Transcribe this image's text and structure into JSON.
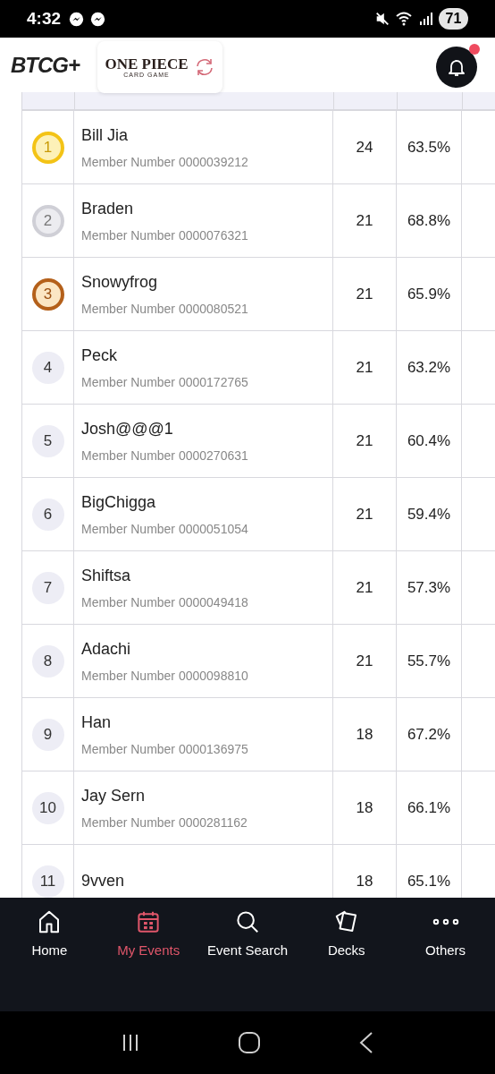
{
  "status_bar": {
    "time": "4:32",
    "battery": "71"
  },
  "header": {
    "logo": "BTCG+",
    "game_logo": {
      "title": "ONE PIECE",
      "subtitle": "CARD GAME"
    },
    "notification_badge": true
  },
  "standings": {
    "rows": [
      {
        "rank": "1",
        "kind": "gold",
        "name": "Bill Jia",
        "member": "Member Number 0000039212",
        "points": "24",
        "percent": "63.5%"
      },
      {
        "rank": "2",
        "kind": "silver",
        "name": "Braden",
        "member": "Member Number 0000076321",
        "points": "21",
        "percent": "68.8%"
      },
      {
        "rank": "3",
        "kind": "bronze",
        "name": "Snowyfrog",
        "member": "Member Number 0000080521",
        "points": "21",
        "percent": "65.9%"
      },
      {
        "rank": "4",
        "kind": "plain",
        "name": "Peck",
        "member": "Member Number 0000172765",
        "points": "21",
        "percent": "63.2%"
      },
      {
        "rank": "5",
        "kind": "plain",
        "name": "Josh@@@1",
        "member": "Member Number 0000270631",
        "points": "21",
        "percent": "60.4%"
      },
      {
        "rank": "6",
        "kind": "plain",
        "name": "BigChigga",
        "member": "Member Number 0000051054",
        "points": "21",
        "percent": "59.4%"
      },
      {
        "rank": "7",
        "kind": "plain",
        "name": "Shiftsa",
        "member": "Member Number 0000049418",
        "points": "21",
        "percent": "57.3%"
      },
      {
        "rank": "8",
        "kind": "plain",
        "name": "Adachi",
        "member": "Member Number 0000098810",
        "points": "21",
        "percent": "55.7%"
      },
      {
        "rank": "9",
        "kind": "plain",
        "name": "Han",
        "member": "Member Number 0000136975",
        "points": "18",
        "percent": "67.2%"
      },
      {
        "rank": "10",
        "kind": "plain",
        "name": "Jay Sern",
        "member": "Member Number 0000281162",
        "points": "18",
        "percent": "66.1%"
      },
      {
        "rank": "11",
        "kind": "plain",
        "name": "9vven",
        "points": "18",
        "percent": "65.1%"
      }
    ]
  },
  "bottom_nav": [
    {
      "label": "Home",
      "kind": "home",
      "selected": false
    },
    {
      "label": "My Events",
      "kind": "calendar",
      "selected": true
    },
    {
      "label": "Event Search",
      "kind": "search",
      "selected": false
    },
    {
      "label": "Decks",
      "kind": "cards",
      "selected": false
    },
    {
      "label": "Others",
      "kind": "more",
      "selected": false
    }
  ]
}
